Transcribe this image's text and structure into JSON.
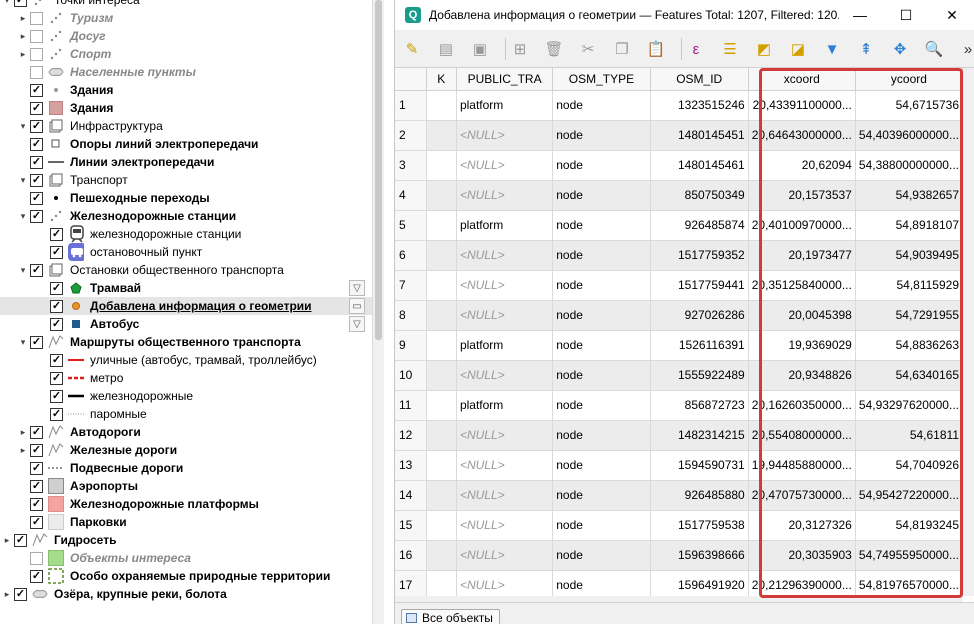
{
  "layer_tree": [
    {
      "label": "Точки интереса",
      "style": "n",
      "level": 0,
      "checked": true,
      "expand": "▾",
      "sym": "pts"
    },
    {
      "label": "Туризм",
      "style": "i",
      "level": 2,
      "checked": false,
      "expand": "▸",
      "sym": "pts"
    },
    {
      "label": "Досуг",
      "style": "i",
      "level": 2,
      "checked": false,
      "expand": "▸",
      "sym": "pts"
    },
    {
      "label": "Спорт",
      "style": "i",
      "level": 2,
      "checked": false,
      "expand": "▸",
      "sym": "pts"
    },
    {
      "label": "Населенные пункты",
      "style": "i",
      "level": 1,
      "checked": false,
      "expand": "",
      "sym": "poly-grey"
    },
    {
      "label": "Здания",
      "style": "b",
      "level": 1,
      "checked": true,
      "expand": "",
      "sym": "dot-grey"
    },
    {
      "label": "Здания",
      "style": "b",
      "level": 1,
      "checked": true,
      "expand": "",
      "sym": "sq-rose"
    },
    {
      "label": "Инфраструктура",
      "style": "n",
      "level": 1,
      "checked": true,
      "expand": "▾",
      "sym": "group"
    },
    {
      "label": "Опоры линий электропередачи",
      "style": "b",
      "level": 2,
      "checked": true,
      "expand": "",
      "sym": "sq-empty"
    },
    {
      "label": "Линии электропередачи",
      "style": "b",
      "level": 2,
      "checked": true,
      "expand": "",
      "sym": "line-grey"
    },
    {
      "label": "Транспорт",
      "style": "n",
      "level": 1,
      "checked": true,
      "expand": "▾",
      "sym": "group"
    },
    {
      "label": "Пешеходные переходы",
      "style": "b",
      "level": 2,
      "checked": true,
      "expand": "",
      "sym": "dot-black"
    },
    {
      "label": "Железнодорожные станции",
      "style": "b",
      "level": 2,
      "checked": true,
      "expand": "▾",
      "sym": "pts"
    },
    {
      "label": "железнодорожные станции",
      "style": "n",
      "level": 3,
      "checked": true,
      "expand": "",
      "sym": "train"
    },
    {
      "label": "остановочный пункт",
      "style": "n",
      "level": 3,
      "checked": true,
      "expand": "",
      "sym": "bus"
    },
    {
      "label": "Остановки общественного транспорта",
      "style": "n",
      "level": 2,
      "checked": true,
      "expand": "▾",
      "sym": "group"
    },
    {
      "label": "Трамвай",
      "style": "b",
      "level": 3,
      "checked": true,
      "expand": "",
      "sym": "pent-green",
      "filter": true
    },
    {
      "label": "Добавлена информация о геометрии",
      "style": "u",
      "level": 3,
      "checked": true,
      "expand": "",
      "sym": "dot-orange",
      "filter": true,
      "highlight": true
    },
    {
      "label": "Автобус",
      "style": "b",
      "level": 3,
      "checked": true,
      "expand": "",
      "sym": "sq-blue",
      "filter": true
    },
    {
      "label": "Маршруты общественного транспорта",
      "style": "b",
      "level": 2,
      "checked": true,
      "expand": "▾",
      "sym": "lines"
    },
    {
      "label": "уличные (автобус, трамвай, троллейбус)",
      "style": "n",
      "level": 3,
      "checked": true,
      "expand": "",
      "sym": "line-red"
    },
    {
      "label": "метро",
      "style": "n",
      "level": 3,
      "checked": true,
      "expand": "",
      "sym": "line-reddash"
    },
    {
      "label": "железнодорожные",
      "style": "n",
      "level": 3,
      "checked": true,
      "expand": "",
      "sym": "line-black"
    },
    {
      "label": "паромные",
      "style": "n",
      "level": 3,
      "checked": true,
      "expand": "",
      "sym": "line-dot"
    },
    {
      "label": "Автодороги",
      "style": "b",
      "level": 2,
      "checked": true,
      "expand": "▸",
      "sym": "lines"
    },
    {
      "label": "Железные дороги",
      "style": "b",
      "level": 2,
      "checked": true,
      "expand": "▸",
      "sym": "lines"
    },
    {
      "label": "Подвесные дороги",
      "style": "b",
      "level": 2,
      "checked": true,
      "expand": "",
      "sym": "line-dash-grey"
    },
    {
      "label": "Аэропорты",
      "style": "b",
      "level": 2,
      "checked": true,
      "expand": "",
      "sym": "sq-grey"
    },
    {
      "label": "Железнодорожные платформы",
      "style": "b",
      "level": 2,
      "checked": true,
      "expand": "",
      "sym": "sq-pink"
    },
    {
      "label": "Парковки",
      "style": "b",
      "level": 2,
      "checked": true,
      "expand": "",
      "sym": "sq-light"
    },
    {
      "label": "Гидросеть",
      "style": "b",
      "level": 0,
      "checked": true,
      "expand": "▸",
      "sym": "lines"
    },
    {
      "label": "Объекты интереса",
      "style": "i",
      "level": 1,
      "checked": false,
      "expand": "",
      "sym": "sq-green"
    },
    {
      "label": "Особо охраняемые природные территории",
      "style": "b",
      "level": 1,
      "checked": true,
      "expand": "",
      "sym": "sq-dashgreen"
    },
    {
      "label": "Озёра, крупные реки, болота",
      "style": "b",
      "level": 0,
      "checked": true,
      "expand": "▸",
      "sym": "poly-grey"
    }
  ],
  "window": {
    "title": "Добавлена информация о геометрии — Features Total: 1207, Filtered: 120...",
    "app_icon": "Q",
    "minimize": "—",
    "maximize": "☐",
    "close": "✕"
  },
  "toolbar_icons": [
    {
      "name": "toggle-editing-icon",
      "glyph": "✎",
      "color": "#c8a000",
      "disabled": true
    },
    {
      "name": "multi-edit-icon",
      "glyph": "▤",
      "color": "#999",
      "disabled": true
    },
    {
      "name": "save-edits-icon",
      "glyph": "▣",
      "color": "#999",
      "disabled": true
    },
    {
      "sep": true
    },
    {
      "name": "add-feature-icon",
      "glyph": "⊞",
      "color": "#999",
      "disabled": true
    },
    {
      "name": "delete-feature-icon",
      "glyph": "🗑",
      "color": "#999",
      "disabled": true
    },
    {
      "name": "cut-icon",
      "glyph": "✂",
      "color": "#999",
      "disabled": true
    },
    {
      "name": "copy-icon",
      "glyph": "❐",
      "color": "#999",
      "disabled": true
    },
    {
      "name": "paste-icon",
      "glyph": "📋",
      "color": "#999",
      "disabled": true
    },
    {
      "sep": true
    },
    {
      "name": "select-by-expression-icon",
      "glyph": "ε",
      "color": "#a0208c",
      "disabled": false
    },
    {
      "name": "select-all-icon",
      "glyph": "☰",
      "color": "#d4a000",
      "disabled": false
    },
    {
      "name": "invert-selection-icon",
      "glyph": "◩",
      "color": "#d4a000",
      "disabled": false
    },
    {
      "name": "deselect-all-icon",
      "glyph": "◪",
      "color": "#d4a000",
      "disabled": false
    },
    {
      "name": "filter-select-icon",
      "glyph": "▼",
      "color": "#2a7fd4",
      "disabled": false
    },
    {
      "name": "move-selection-top-icon",
      "glyph": "⇞",
      "color": "#2a7fd4",
      "disabled": false
    },
    {
      "name": "pan-to-selected-icon",
      "glyph": "✥",
      "color": "#2a7fd4",
      "disabled": false
    },
    {
      "name": "zoom-to-selected-icon",
      "glyph": "🔍",
      "color": "#c8a000",
      "disabled": false
    },
    {
      "name": "more-tools-icon",
      "glyph": "»",
      "color": "#333",
      "disabled": false
    }
  ],
  "table": {
    "columns": [
      "K",
      "PUBLIC_TRA",
      "OSM_TYPE",
      "OSM_ID",
      "xcoord",
      "ycoord"
    ],
    "rows": [
      {
        "n": "1",
        "k": "",
        "pub": "platform",
        "type": "node",
        "id": "1323515246",
        "x": "20,43391100000...",
        "y": "54,6715736"
      },
      {
        "n": "2",
        "k": "",
        "pub": "<NULL>",
        "type": "node",
        "id": "1480145451",
        "x": "20,64643000000...",
        "y": "54,40396000000..."
      },
      {
        "n": "3",
        "k": "",
        "pub": "<NULL>",
        "type": "node",
        "id": "1480145461",
        "x": "20,62094",
        "y": "54,38800000000..."
      },
      {
        "n": "4",
        "k": "",
        "pub": "<NULL>",
        "type": "node",
        "id": "850750349",
        "x": "20,1573537",
        "y": "54,9382657"
      },
      {
        "n": "5",
        "k": "",
        "pub": "platform",
        "type": "node",
        "id": "926485874",
        "x": "20,40100970000...",
        "y": "54,8918107"
      },
      {
        "n": "6",
        "k": "",
        "pub": "<NULL>",
        "type": "node",
        "id": "1517759352",
        "x": "20,1973477",
        "y": "54,9039495"
      },
      {
        "n": "7",
        "k": "",
        "pub": "<NULL>",
        "type": "node",
        "id": "1517759441",
        "x": "20,35125840000...",
        "y": "54,8115929"
      },
      {
        "n": "8",
        "k": "",
        "pub": "<NULL>",
        "type": "node",
        "id": "927026286",
        "x": "20,0045398",
        "y": "54,7291955"
      },
      {
        "n": "9",
        "k": "",
        "pub": "platform",
        "type": "node",
        "id": "1526116391",
        "x": "19,9369029",
        "y": "54,8836263"
      },
      {
        "n": "10",
        "k": "",
        "pub": "<NULL>",
        "type": "node",
        "id": "1555922489",
        "x": "20,9348826",
        "y": "54,6340165"
      },
      {
        "n": "11",
        "k": "",
        "pub": "platform",
        "type": "node",
        "id": "856872723",
        "x": "20,16260350000...",
        "y": "54,93297620000..."
      },
      {
        "n": "12",
        "k": "",
        "pub": "<NULL>",
        "type": "node",
        "id": "1482314215",
        "x": "20,55408000000...",
        "y": "54,61811"
      },
      {
        "n": "13",
        "k": "",
        "pub": "<NULL>",
        "type": "node",
        "id": "1594590731",
        "x": "19,94485880000...",
        "y": "54,7040926"
      },
      {
        "n": "14",
        "k": "",
        "pub": "<NULL>",
        "type": "node",
        "id": "926485880",
        "x": "20,47075730000...",
        "y": "54,95427220000..."
      },
      {
        "n": "15",
        "k": "",
        "pub": "<NULL>",
        "type": "node",
        "id": "1517759538",
        "x": "20,3127326",
        "y": "54,8193245"
      },
      {
        "n": "16",
        "k": "",
        "pub": "<NULL>",
        "type": "node",
        "id": "1596398666",
        "x": "20,3035903",
        "y": "54,74955950000..."
      },
      {
        "n": "17",
        "k": "",
        "pub": "<NULL>",
        "type": "node",
        "id": "1596491920",
        "x": "20,21296390000...",
        "y": "54,81976570000..."
      }
    ]
  },
  "statusbar": {
    "show_all_label": "Все объекты"
  },
  "highlight_color": "#d33b3b"
}
